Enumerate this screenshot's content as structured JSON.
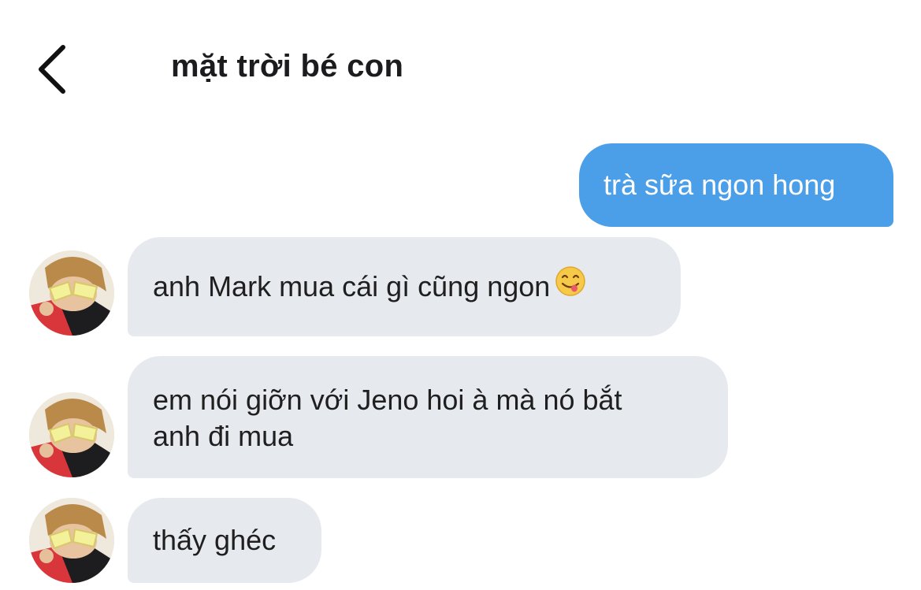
{
  "header": {
    "title": "mặt trời bé con",
    "back_icon": "chevron-left-icon"
  },
  "messages": [
    {
      "direction": "outgoing",
      "text": "trà sữa ngon hong"
    },
    {
      "direction": "incoming",
      "text": "anh Mark mua cái gì cũng ngon",
      "emoji": "face-savoring-food-icon"
    },
    {
      "direction": "incoming",
      "text": "em nói giỡn với Jeno hoi à mà nó bắt\nanh đi mua"
    },
    {
      "direction": "incoming",
      "text": "thấy ghéc"
    }
  ],
  "colors": {
    "outgoing_bubble": "#4b9ee8",
    "incoming_bubble": "#e6e9ee",
    "title": "#1c1c1e"
  }
}
